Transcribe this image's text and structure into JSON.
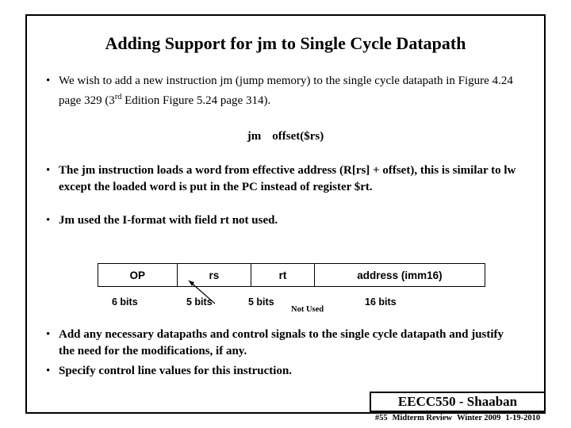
{
  "slide": {
    "title": "Adding Support for jm to Single Cycle Datapath",
    "bullets": [
      {
        "marker": "•",
        "text_part1": "We wish to add  a new instruction jm (jump memory)  to the single cycle datapath in Figure 4.24 page 329 (3",
        "superscript": "rd",
        "text_part2": " Edition Figure 5.24 page 314)."
      },
      {
        "marker": "•",
        "text": "The jm instruction loads a word from effective address (R[rs] + offset), this is similar to lw except the loaded word is put in the PC instead of register $rt."
      },
      {
        "marker": "•",
        "text": "Jm used the I-format with field  rt not used."
      },
      {
        "marker": "•",
        "text": "Add any necessary datapaths and control signals to the single cycle datapath and justify the need for the modifications, if any."
      },
      {
        "marker": "•",
        "text": "Specify control line values for this instruction."
      }
    ],
    "syntax_line": {
      "mnemonic": "jm",
      "operand": "offset($rs)"
    },
    "format_table": {
      "fields": [
        "OP",
        "rs",
        "rt",
        "address (imm16)"
      ],
      "bits": [
        "6 bits",
        "5 bits",
        "5 bits",
        "16  bits"
      ],
      "annotation": "Not Used"
    },
    "footer": {
      "course": "EECC550 - Shaaban",
      "slide_number": "#55",
      "topic": "Midterm Review",
      "term": "Winter 2009",
      "date": "1-19-2010"
    }
  }
}
